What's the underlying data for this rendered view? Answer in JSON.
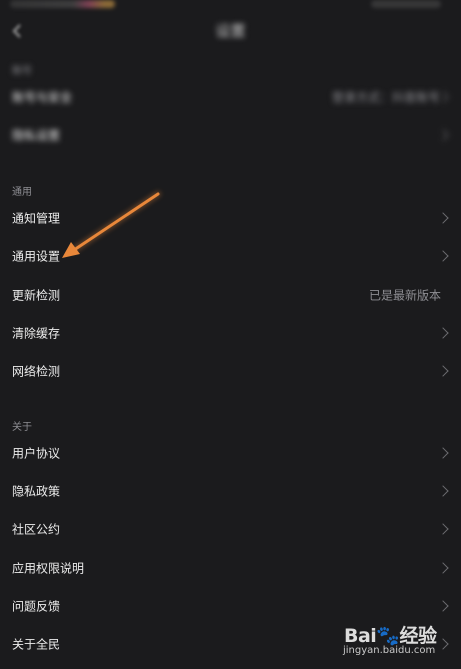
{
  "page": {
    "title": "设置"
  },
  "account_section": {
    "label": "账号",
    "rows": [
      {
        "label": "账号与安全",
        "value": "登录方式：抖音账号"
      },
      {
        "label": "隐私设置",
        "value": ""
      }
    ]
  },
  "general_section": {
    "label": "通用",
    "rows": [
      {
        "label": "通知管理",
        "value": ""
      },
      {
        "label": "通用设置",
        "value": ""
      },
      {
        "label": "更新检测",
        "value": "已是最新版本"
      },
      {
        "label": "清除缓存",
        "value": ""
      },
      {
        "label": "网络检测",
        "value": ""
      }
    ]
  },
  "about_section": {
    "label": "关于",
    "rows": [
      {
        "label": "用户协议",
        "value": ""
      },
      {
        "label": "隐私政策",
        "value": ""
      },
      {
        "label": "社区公约",
        "value": ""
      },
      {
        "label": "应用权限说明",
        "value": ""
      },
      {
        "label": "问题反馈",
        "value": ""
      },
      {
        "label": "关于全民",
        "value": ""
      }
    ]
  },
  "watermark": {
    "logo": "Bai🐾经验",
    "url": "jingyan.baidu.com"
  },
  "colors": {
    "background": "#1b1b1d",
    "arrow": "#e8873a",
    "secondary_text": "#8e8e93"
  }
}
